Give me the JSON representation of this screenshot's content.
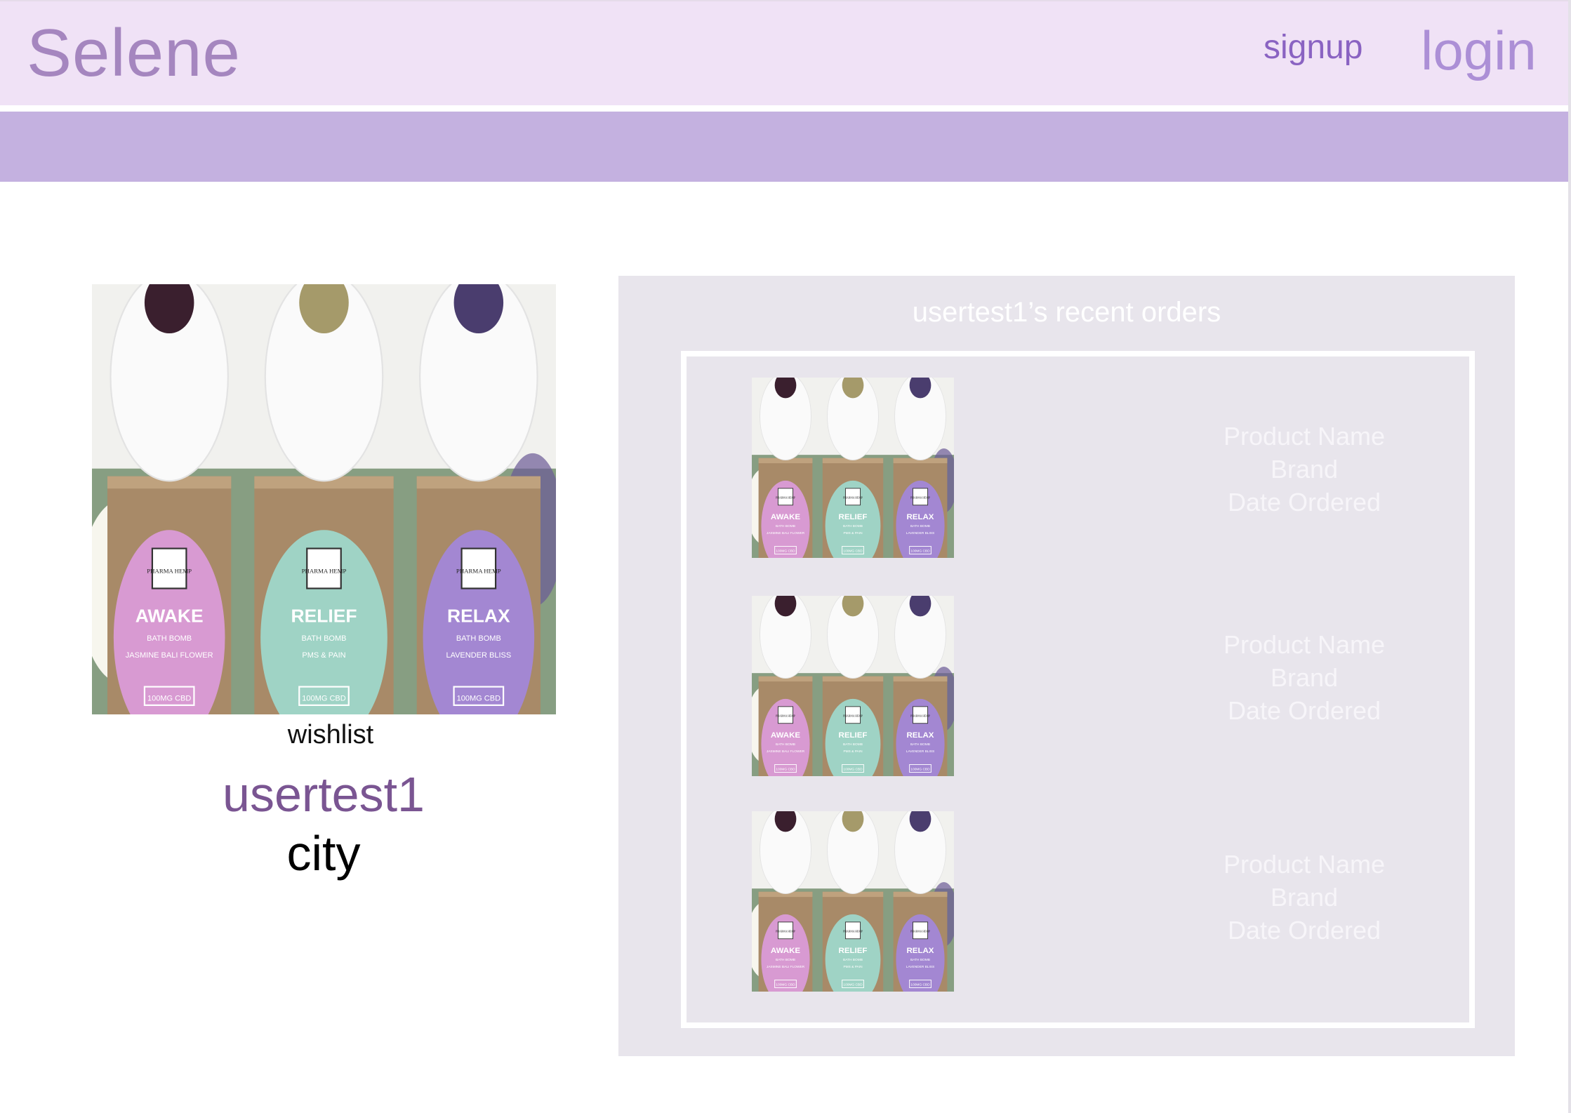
{
  "header": {
    "brand": "Selene",
    "signup_label": "signup",
    "login_label": "login"
  },
  "profile": {
    "photo_icon": "bath-bombs-photo",
    "wishlist_label": "wishlist",
    "username": "usertest1",
    "city": "city"
  },
  "product_photo": {
    "labels": [
      "AWAKE",
      "RELIEF",
      "RELAX"
    ],
    "sub_labels": [
      "BATH BOMB",
      "BATH BOMB",
      "BATH BOMB"
    ],
    "details": [
      "JASMINE BALI FLOWER",
      "PMS & PAIN",
      "LAVENDER BLISS"
    ],
    "badge": "100MG CBD",
    "brand_mark": "PHARMA HEMP"
  },
  "orders": {
    "title": "usertest1’s recent orders",
    "items": [
      {
        "product_name": "Product Name",
        "brand": "Brand",
        "date_ordered": "Date Ordered"
      },
      {
        "product_name": "Product Name",
        "brand": "Brand",
        "date_ordered": "Date Ordered"
      },
      {
        "product_name": "Product Name",
        "brand": "Brand",
        "date_ordered": "Date Ordered"
      }
    ]
  },
  "colors": {
    "header_bg": "#f0e2f6",
    "subnav_bg": "#c4b1e0",
    "brand": "#a586bf",
    "signup": "#8a63c2",
    "login": "#ac8fd6",
    "username": "#7a5592",
    "panel_bg": "#e8e5ec",
    "awake_label": "#d89ad2",
    "relief_label": "#9fd3c5",
    "relax_label": "#a387d2"
  }
}
